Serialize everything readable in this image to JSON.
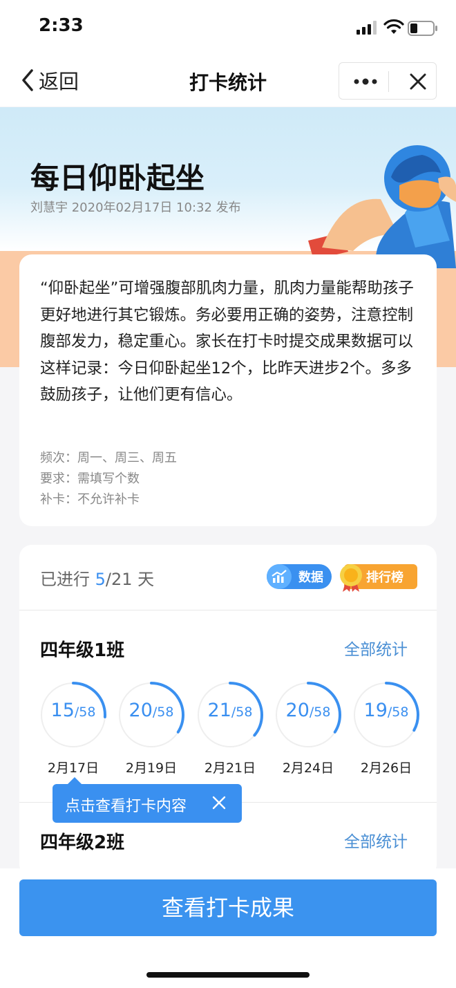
{
  "status_bar": {
    "time": "2:33"
  },
  "nav": {
    "back_label": "返回",
    "title": "打卡统计"
  },
  "header": {
    "title": "每日仰卧起坐",
    "meta": "刘慧宇 2020年02月17日 10:32 发布"
  },
  "description": {
    "text": "“仰卧起坐”可增强腹部肌肉力量，肌肉力量能帮助孩子更好地进行其它锻炼。务必要用正确的姿势，注意控制腹部发力，稳定重心。家长在打卡时提交成果数据可以这样记录：今日仰卧起坐12个，比昨天进步2个。多多鼓励孩子，让他们更有信心。",
    "frequency": "频次：周一、周三、周五",
    "requirement": "要求：需填写个数",
    "makeup": "补卡：不允许补卡"
  },
  "progress": {
    "prefix": "已进行 ",
    "current": "5",
    "suffix": "/21 天"
  },
  "buttons": {
    "data": "数据",
    "ranking": "排行榜",
    "view_results": "查看打卡成果"
  },
  "classes": [
    {
      "name": "四年级1班",
      "all_stats": "全部统计",
      "days": [
        {
          "count": "15",
          "total": "/58",
          "date": "2月17日",
          "ratio": 0.26
        },
        {
          "count": "20",
          "total": "/58",
          "date": "2月19日",
          "ratio": 0.34
        },
        {
          "count": "21",
          "total": "/58",
          "date": "2月21日",
          "ratio": 0.36
        },
        {
          "count": "20",
          "total": "/58",
          "date": "2月24日",
          "ratio": 0.34
        },
        {
          "count": "19",
          "total": "/58",
          "date": "2月26日",
          "ratio": 0.33
        }
      ]
    },
    {
      "name": "四年级2班",
      "all_stats": "全部统计"
    }
  ],
  "tooltip": {
    "text": "点击查看打卡内容"
  },
  "colors": {
    "accent": "#3a90f0",
    "ranking": "#f8a431",
    "banner_peach": "#fbcaa5"
  }
}
